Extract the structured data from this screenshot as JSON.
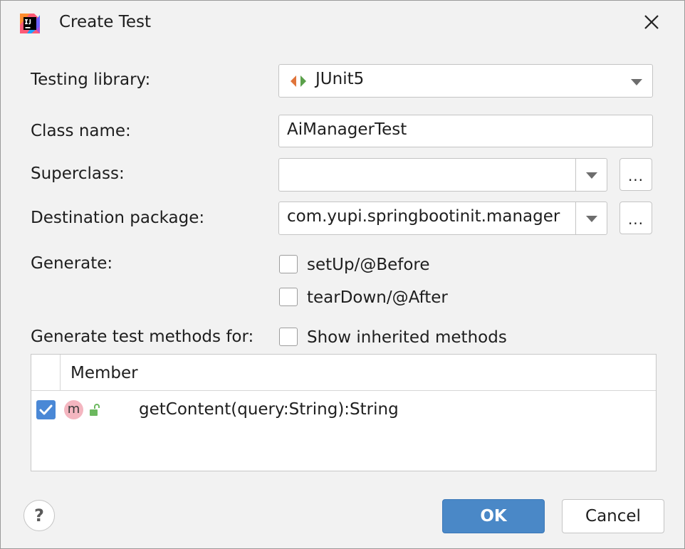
{
  "dialog": {
    "title": "Create Test",
    "app_icon": "intellij-idea-icon",
    "close_icon": "close-icon"
  },
  "form": {
    "testing_library": {
      "label": "Testing library:",
      "value": "JUnit5",
      "icon": "junit-icon"
    },
    "class_name": {
      "label": "Class name:",
      "value": "AiManagerTest"
    },
    "superclass": {
      "label": "Superclass:",
      "value": "",
      "browse": "..."
    },
    "destination_package": {
      "label": "Destination package:",
      "value": "com.yupi.springbootinit.manager",
      "browse": "..."
    },
    "generate": {
      "label": "Generate:",
      "options": [
        {
          "label": "setUp/@Before",
          "checked": false
        },
        {
          "label": "tearDown/@After",
          "checked": false
        }
      ]
    },
    "methods": {
      "label": "Generate test methods for:",
      "show_inherited": {
        "label": "Show inherited methods",
        "checked": false
      }
    }
  },
  "table": {
    "header": "Member",
    "rows": [
      {
        "checked": true,
        "badge": "m",
        "visibility_icon": "unlock-icon",
        "text": "getContent(query:String):String"
      }
    ]
  },
  "footer": {
    "help": "?",
    "ok": "OK",
    "cancel": "Cancel"
  },
  "colors": {
    "accent": "#4a88c7",
    "checkbox_checked": "#4a88d6",
    "method_badge": "#f4b6c0",
    "junit_orange": "#e0743a",
    "junit_green": "#5aa04a",
    "unlock_green": "#6cb85f"
  }
}
